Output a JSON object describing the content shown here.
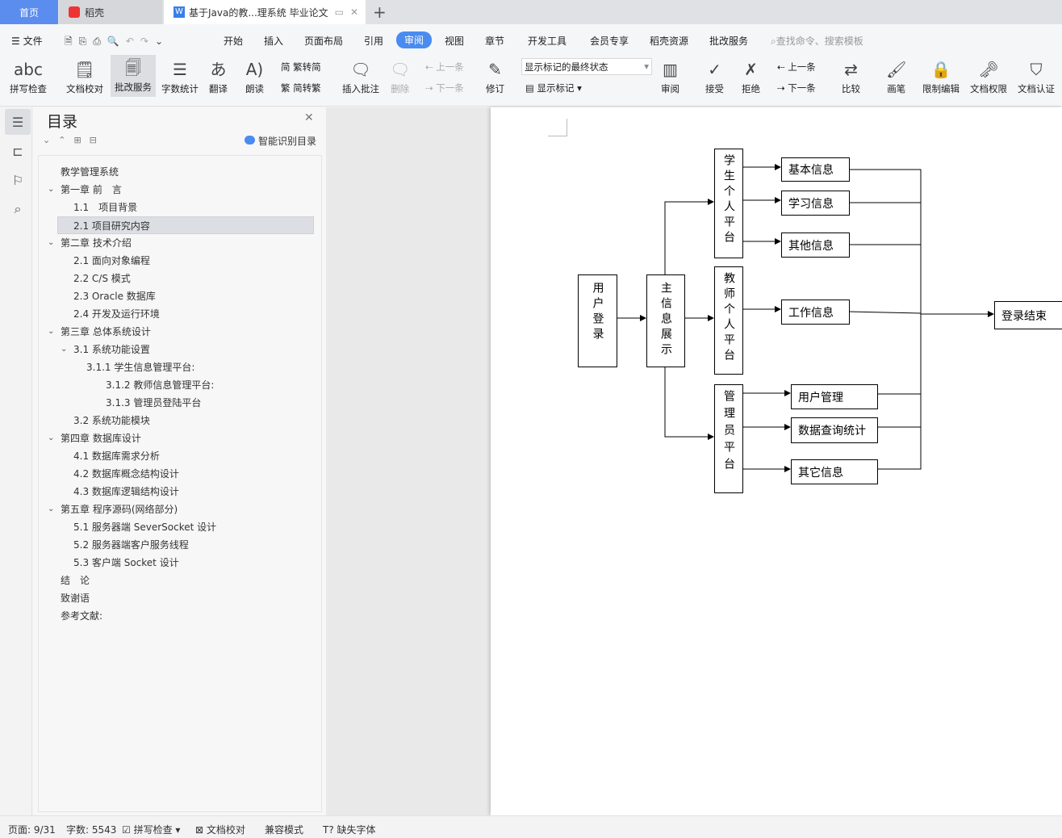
{
  "tabs": [
    {
      "label": "首页"
    },
    {
      "label": "稻壳"
    },
    {
      "label": "基于Java的教...理系统 毕业论文"
    }
  ],
  "colors": {
    "accent": "#4a8bf0",
    "home_tab": "#5b8def",
    "selected_toc": "#dcdee3"
  },
  "menu": {
    "file": "文件",
    "items": [
      "开始",
      "插入",
      "页面布局",
      "引用",
      "审阅",
      "视图",
      "章节",
      "开发工具",
      "会员专享",
      "稻壳资源",
      "批改服务"
    ],
    "active": "审阅",
    "search_placeholder": "查找命令、搜索模板"
  },
  "ribbon": {
    "spell": "拼写检查",
    "proof": "文档校对",
    "review_service": "批改服务",
    "wordcount": "字数统计",
    "translate": "翻译",
    "read": "朗读",
    "trad2simp": "繁转简",
    "simp2trad": "简转繁",
    "insert_comment": "插入批注",
    "delete": "删除",
    "prev_comment": "上一条",
    "next_comment": "下一条",
    "track": "修订",
    "markup_state": "显示标记的最终状态",
    "show_markup": "显示标记",
    "review": "审阅",
    "accept": "接受",
    "reject": "拒绝",
    "prev": "上一条",
    "next": "下一条",
    "compare": "比较",
    "pen": "画笔",
    "restrict": "限制编辑",
    "permission": "文档权限",
    "certify": "文档认证"
  },
  "toc": {
    "title": "目录",
    "smart": "智能识别目录",
    "items": [
      {
        "label": "教学管理系统",
        "level": 0,
        "expand": false
      },
      {
        "label": "第一章 前　言",
        "level": 0,
        "expand": true
      },
      {
        "label": "1.1　项目背景",
        "level": 1
      },
      {
        "label": "2.1  项目研究内容",
        "level": 1,
        "selected": true
      },
      {
        "label": "第二章  技术介绍",
        "level": 0,
        "expand": true
      },
      {
        "label": "2.1  面向对象编程",
        "level": 1
      },
      {
        "label": "2.2 C/S 模式",
        "level": 1
      },
      {
        "label": "2.3 Oracle  数据库",
        "level": 1
      },
      {
        "label": "2.4  开发及运行环境",
        "level": 1
      },
      {
        "label": "第三章  总体系统设计",
        "level": 0,
        "expand": true
      },
      {
        "label": "3.1  系统功能设置",
        "level": 1,
        "expand": true
      },
      {
        "label": "3.1.1  学生信息管理平台:",
        "level": 2
      },
      {
        "label": "3.1.2  教师信息管理平台:",
        "level": 3
      },
      {
        "label": "3.1.3  管理员登陆平台",
        "level": 3
      },
      {
        "label": "3.2  系统功能模块",
        "level": 1
      },
      {
        "label": "第四章  数据库设计",
        "level": 0,
        "expand": true
      },
      {
        "label": "4.1  数据库需求分析",
        "level": 1
      },
      {
        "label": "4.2  数据库概念结构设计",
        "level": 1
      },
      {
        "label": "4.3  数据库逻辑结构设计",
        "level": 1
      },
      {
        "label": "第五章  程序源码(网络部分)",
        "level": 0,
        "expand": true
      },
      {
        "label": "5.1  服务器端 SeverSocket 设计",
        "level": 1
      },
      {
        "label": "5.2  服务器端客户服务线程",
        "level": 1
      },
      {
        "label": "5.3  客户端 Socket 设计",
        "level": 1
      },
      {
        "label": "结　论",
        "level": 0
      },
      {
        "label": "致谢语",
        "level": 0
      },
      {
        "label": "参考文献:",
        "level": 0
      }
    ]
  },
  "diagram": {
    "login": "用户登录",
    "main": "主信息展示",
    "student": "学生个人平台",
    "teacher": "教师个人平台",
    "admin": "管理员平台",
    "basic": "基本信息",
    "study": "学习信息",
    "other1": "其他信息",
    "work": "工作信息",
    "usermgr": "用户管理",
    "query": "数据查询统计",
    "other2": "其它信息",
    "end": "登录结束"
  },
  "status": {
    "page": "页面: 9/31",
    "words": "字数: 5543",
    "spell": "拼写检查",
    "proof": "文档校对",
    "compat": "兼容模式",
    "missing_font": "缺失字体"
  }
}
